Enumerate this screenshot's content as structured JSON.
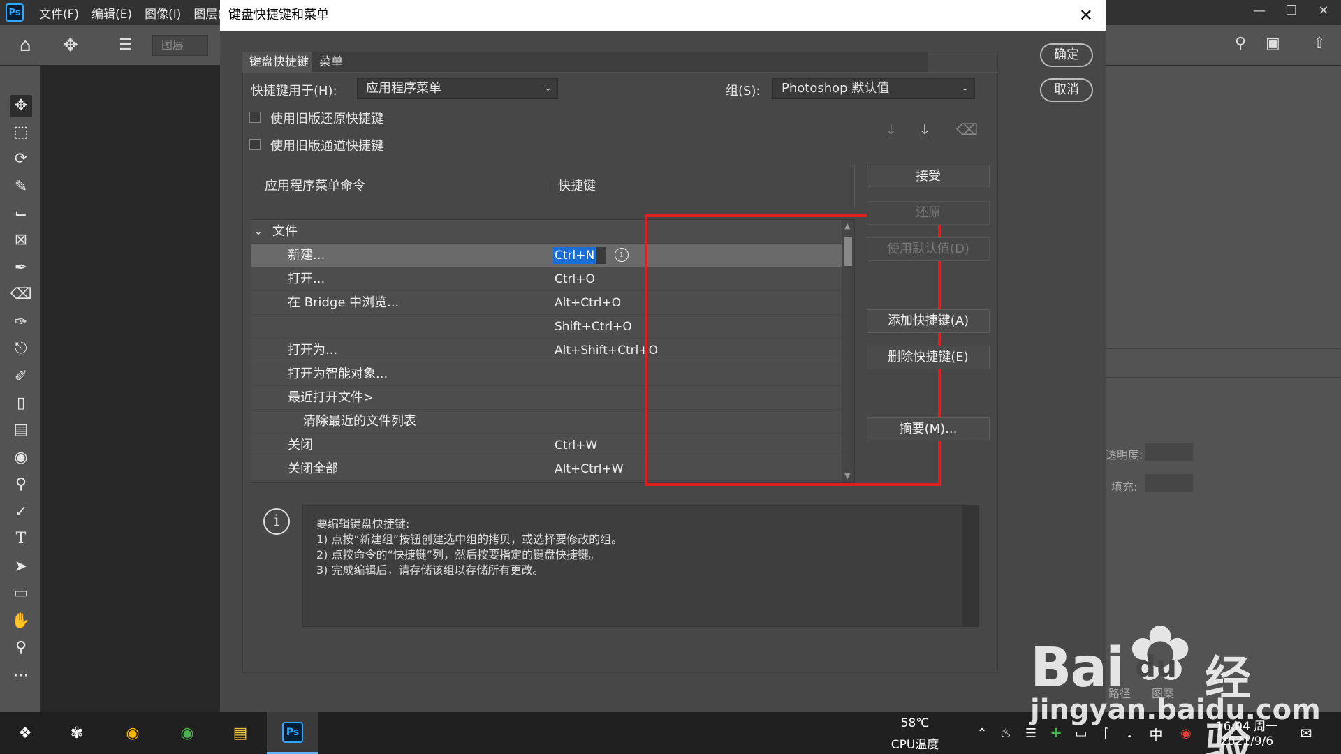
{
  "app": {
    "logo": "Ps",
    "menus": [
      "文件(F)",
      "编辑(E)",
      "图像(I)",
      "图层("
    ],
    "layers_dropdown": "图层"
  },
  "dialog": {
    "title": "键盘快捷键和菜单",
    "tabs": [
      "键盘快捷键",
      "菜单"
    ],
    "shortcuts_for_label": "快捷键用于(H):",
    "shortcuts_for_value": "应用程序菜单",
    "set_label": "组(S):",
    "set_value": "Photoshop 默认值",
    "checkbox_undo": "使用旧版还原快捷键",
    "checkbox_channel": "使用旧版通道快捷键",
    "ok": "确定",
    "cancel": "取消",
    "col_command": "应用程序菜单命令",
    "col_shortcut": "快捷键",
    "buttons": {
      "accept": "接受",
      "undo": "还原",
      "use_default": "使用默认值(D)",
      "add_shortcut": "添加快捷键(A)",
      "delete_shortcut": "删除快捷键(E)",
      "summarize": "摘要(M)..."
    },
    "group_name": "文件",
    "rows": [
      {
        "cmd": "新建...",
        "key": "Ctrl+N",
        "indent": 1
      },
      {
        "cmd": "打开...",
        "key": "Ctrl+O",
        "indent": 1
      },
      {
        "cmd": "在 Bridge 中浏览...",
        "key": "Alt+Ctrl+O",
        "indent": 1
      },
      {
        "cmd": "",
        "key": "Shift+Ctrl+O",
        "indent": 1
      },
      {
        "cmd": "打开为...",
        "key": "Alt+Shift+Ctrl+O",
        "indent": 1
      },
      {
        "cmd": "打开为智能对象...",
        "key": "",
        "indent": 1
      },
      {
        "cmd": "最近打开文件>",
        "key": "",
        "indent": 1
      },
      {
        "cmd": "清除最近的文件列表",
        "key": "",
        "indent": 2
      },
      {
        "cmd": "关闭",
        "key": "Ctrl+W",
        "indent": 1
      },
      {
        "cmd": "关闭全部",
        "key": "Alt+Ctrl+W",
        "indent": 1
      }
    ],
    "info_lines": [
      "要编辑键盘快捷键:",
      "1) 点按“新建组”按钮创建选中组的拷贝，或选择要修改的组。",
      "2) 点按命令的“快捷键”列，然后按要指定的键盘快捷键。",
      "3) 完成编辑后，请存储该组以存储所有更改。"
    ]
  },
  "right_panel": {
    "opacity_label": "透明度:",
    "fill_label": "填充:",
    "tabs": [
      "路径",
      "图案"
    ]
  },
  "taskbar": {
    "temp": "58℃",
    "temp_label": "CPU温度",
    "ime": "中",
    "time": "16:04 周一",
    "date": "2021/9/6"
  },
  "watermark": {
    "brand": "Bai",
    "brand2": "du",
    "brand3": "经验",
    "url": "jingyan.baidu.com"
  }
}
